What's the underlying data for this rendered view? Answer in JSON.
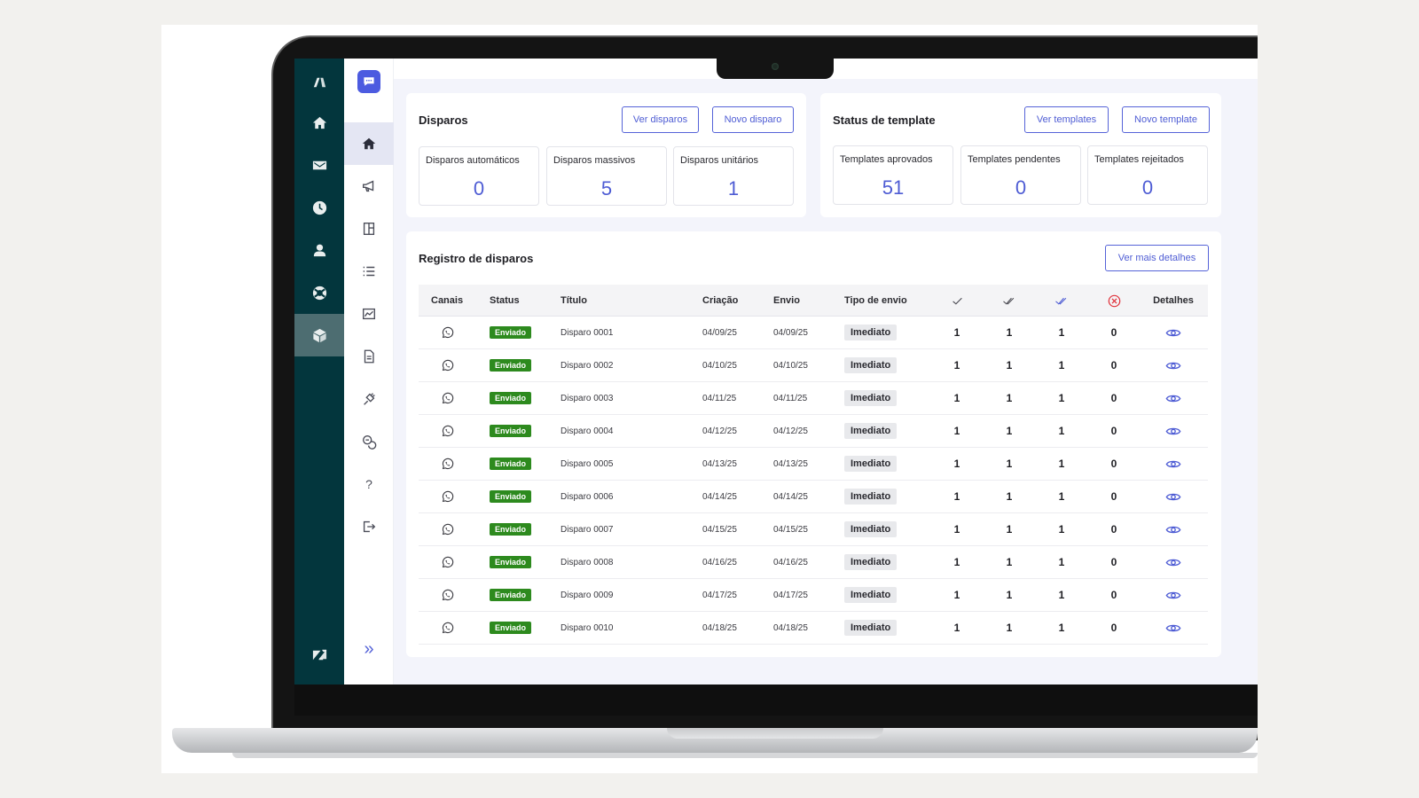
{
  "disparos": {
    "title": "Disparos",
    "ver_button": "Ver disparos",
    "novo_button": "Novo disparo",
    "stats": [
      {
        "label": "Disparos automáticos",
        "value": "0"
      },
      {
        "label": "Disparos massivos",
        "value": "5"
      },
      {
        "label": "Disparos unitários",
        "value": "1"
      }
    ]
  },
  "templates": {
    "title": "Status de template",
    "ver_button": "Ver templates",
    "novo_button": "Novo template",
    "stats": [
      {
        "label": "Templates aprovados",
        "value": "51"
      },
      {
        "label": "Templates pendentes",
        "value": "0"
      },
      {
        "label": "Templates rejeitados",
        "value": "0"
      }
    ]
  },
  "registro": {
    "title": "Registro de disparos",
    "details_button": "Ver mais detalhes",
    "headers": {
      "canais": "Canais",
      "status": "Status",
      "titulo": "Título",
      "criacao": "Criação",
      "envio": "Envio",
      "tipo": "Tipo de envio",
      "detalhes": "Detalhes"
    },
    "rows": [
      {
        "status": "Enviado",
        "titulo": "Disparo 0001",
        "criacao": "04/09/25",
        "envio": "04/09/25",
        "tipo": "Imediato",
        "sent": "1",
        "delivered": "1",
        "read": "1",
        "failed": "0"
      },
      {
        "status": "Enviado",
        "titulo": "Disparo 0002",
        "criacao": "04/10/25",
        "envio": "04/10/25",
        "tipo": "Imediato",
        "sent": "1",
        "delivered": "1",
        "read": "1",
        "failed": "0"
      },
      {
        "status": "Enviado",
        "titulo": "Disparo 0003",
        "criacao": "04/11/25",
        "envio": "04/11/25",
        "tipo": "Imediato",
        "sent": "1",
        "delivered": "1",
        "read": "1",
        "failed": "0"
      },
      {
        "status": "Enviado",
        "titulo": "Disparo 0004",
        "criacao": "04/12/25",
        "envio": "04/12/25",
        "tipo": "Imediato",
        "sent": "1",
        "delivered": "1",
        "read": "1",
        "failed": "0"
      },
      {
        "status": "Enviado",
        "titulo": "Disparo 0005",
        "criacao": "04/13/25",
        "envio": "04/13/25",
        "tipo": "Imediato",
        "sent": "1",
        "delivered": "1",
        "read": "1",
        "failed": "0"
      },
      {
        "status": "Enviado",
        "titulo": "Disparo 0006",
        "criacao": "04/14/25",
        "envio": "04/14/25",
        "tipo": "Imediato",
        "sent": "1",
        "delivered": "1",
        "read": "1",
        "failed": "0"
      },
      {
        "status": "Enviado",
        "titulo": "Disparo 0007",
        "criacao": "04/15/25",
        "envio": "04/15/25",
        "tipo": "Imediato",
        "sent": "1",
        "delivered": "1",
        "read": "1",
        "failed": "0"
      },
      {
        "status": "Enviado",
        "titulo": "Disparo 0008",
        "criacao": "04/16/25",
        "envio": "04/16/25",
        "tipo": "Imediato",
        "sent": "1",
        "delivered": "1",
        "read": "1",
        "failed": "0"
      },
      {
        "status": "Enviado",
        "titulo": "Disparo 0009",
        "criacao": "04/17/25",
        "envio": "04/17/25",
        "tipo": "Imediato",
        "sent": "1",
        "delivered": "1",
        "read": "1",
        "failed": "0"
      },
      {
        "status": "Enviado",
        "titulo": "Disparo 0010",
        "criacao": "04/18/25",
        "envio": "04/18/25",
        "tipo": "Imediato",
        "sent": "1",
        "delivered": "1",
        "read": "1",
        "failed": "0"
      }
    ]
  },
  "sidebar": {
    "rail_icons": [
      "logo-icon",
      "home-icon",
      "mail-icon",
      "clock-icon",
      "user-icon",
      "support-icon",
      "box-icon",
      "zendesk-logo"
    ],
    "active_rail": "box-icon",
    "panel_icons": [
      "chat-logo-icon",
      "home-icon",
      "megaphone-icon",
      "template-icon",
      "list-icon",
      "chart-icon",
      "document-icon",
      "plug-icon",
      "chats-icon",
      "help-icon",
      "logout-icon",
      "expand-icon"
    ],
    "help_glyph": "?",
    "expand_glyph": "»"
  },
  "colors": {
    "rail_bg": "#03363d",
    "accent": "#4e5cd4",
    "status_sent": "#2d8a1e",
    "failed_icon": "#e0303a"
  }
}
